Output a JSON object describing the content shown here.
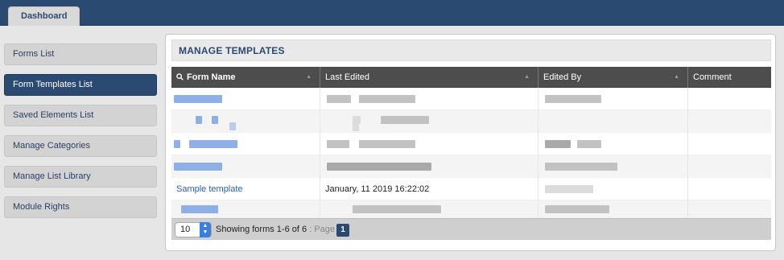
{
  "header": {
    "tab_label": "Dashboard"
  },
  "sidebar": {
    "items": [
      {
        "label": "Forms List",
        "active": false
      },
      {
        "label": "Form Templates List",
        "active": true
      },
      {
        "label": "Saved Elements List",
        "active": false
      },
      {
        "label": "Manage Categories",
        "active": false
      },
      {
        "label": "Manage List Library",
        "active": false
      },
      {
        "label": "Module Rights",
        "active": false
      }
    ]
  },
  "panel": {
    "title": "MANAGE TEMPLATES",
    "columns": [
      "Form Name",
      "Last Edited",
      "Edited By",
      "Comment"
    ],
    "rows": [
      {
        "name": "",
        "last_edited": "",
        "edited_by": "",
        "comment": ""
      },
      {
        "name": "",
        "last_edited": "",
        "edited_by": "",
        "comment": ""
      },
      {
        "name": "",
        "last_edited": "",
        "edited_by": "",
        "comment": ""
      },
      {
        "name": "",
        "last_edited": "",
        "edited_by": "",
        "comment": ""
      },
      {
        "name": "Sample template",
        "last_edited": "January, 11 2019 16:22:02",
        "edited_by": "",
        "comment": ""
      },
      {
        "name": "",
        "last_edited": "",
        "edited_by": "",
        "comment": ""
      }
    ],
    "footer": {
      "page_size": "10",
      "showing": "Showing forms 1-6 of 6",
      "page_label": ": Page",
      "current_page": "1"
    }
  },
  "icons": {
    "search": "magnifier-icon",
    "sort": "sort-arrow-icon",
    "select": "updown-arrows-icon"
  },
  "colors": {
    "brand": "#2b4a72",
    "link": "#2a5db0",
    "header_bg": "#4d4d4d"
  }
}
